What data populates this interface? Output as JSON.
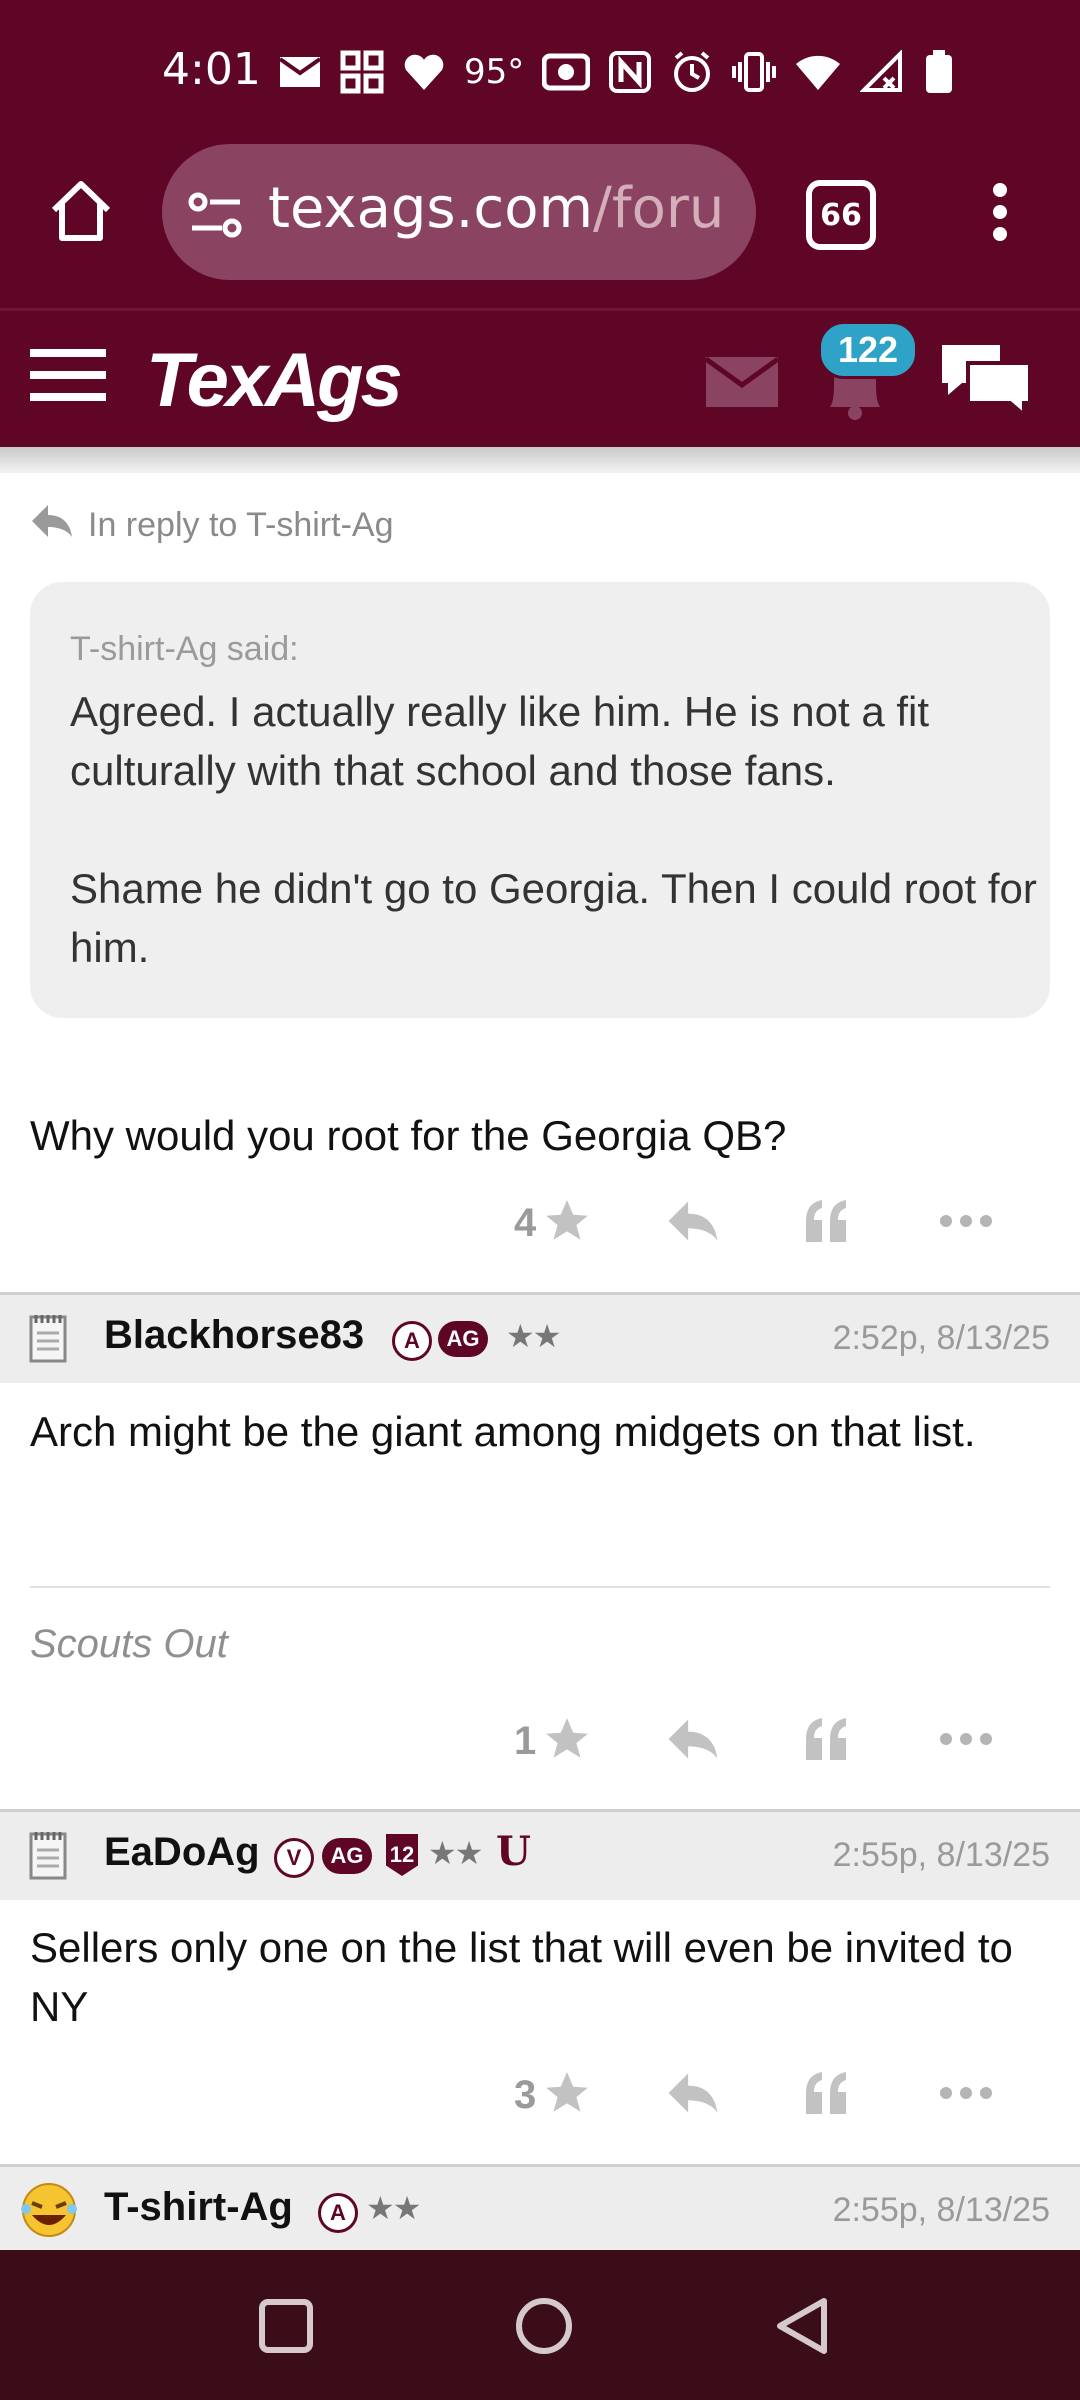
{
  "status_bar": {
    "time": "4:01",
    "temperature": "95°"
  },
  "browser": {
    "url_domain": "texags.com",
    "url_path": "/forum",
    "tab_count": "66"
  },
  "site": {
    "logo": "TexAgs",
    "notification_count": "122"
  },
  "reply": {
    "label": "In reply to T-shirt-Ag",
    "quote_author": "T-shirt-Ag said:",
    "quote_text": "Agreed. I actually really like him. He is not a fit culturally with that school and those fans.\n\nShame he didn't go to Georgia. Then I could root for him.",
    "body": "Why would you root for the Georgia QB?",
    "star_count": "4"
  },
  "posts": [
    {
      "username": "Blackhorse83",
      "badges": [
        "A",
        "AG"
      ],
      "stars": "★★",
      "time": "2:52p, 8/13/25",
      "body": "Arch might be the giant among midgets on that list.",
      "signature": "Scouts Out",
      "star_count": "1"
    },
    {
      "username": "EaDoAg",
      "badges": [
        "V",
        "AG",
        "12"
      ],
      "stars": "★★",
      "extra_badge": "U",
      "time": "2:55p, 8/13/25",
      "body": "Sellers only one on the list that will even be invited to NY",
      "star_count": "3"
    },
    {
      "username": "T-shirt-Ag",
      "badges": [
        "A"
      ],
      "stars": "★★",
      "time": "2:55p, 8/13/25"
    }
  ],
  "colors": {
    "brand": "#5f0626",
    "accent": "#2ea3c7",
    "muted": "#9a9a9a"
  }
}
